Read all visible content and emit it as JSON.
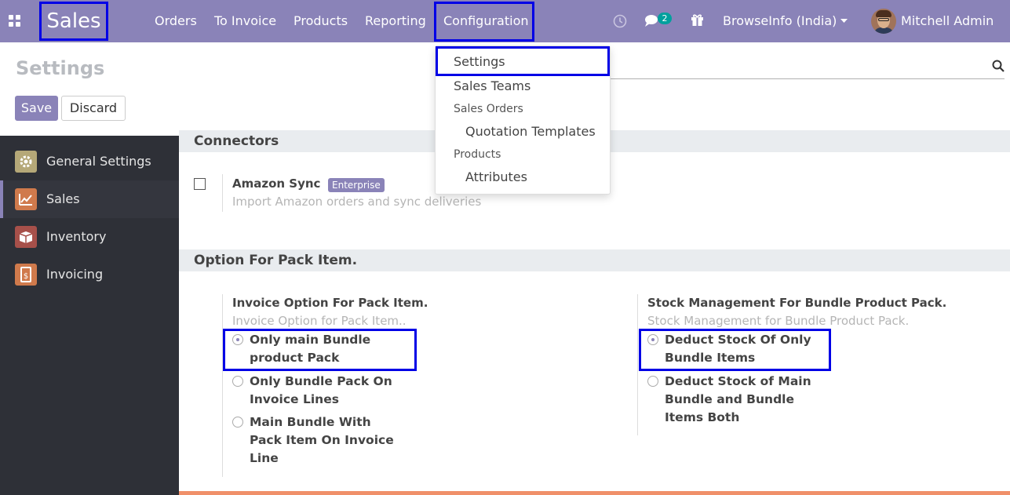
{
  "topbar": {
    "app_name": "Sales",
    "menu": [
      "Orders",
      "To Invoice",
      "Products",
      "Reporting",
      "Configuration"
    ],
    "chat_count": "2",
    "company": "BrowseInfo (India)",
    "user": "Mitchell Admin",
    "icons": [
      "apps-grid-icon",
      "clock-icon",
      "chat-icon",
      "gift-icon",
      "caret-down-icon"
    ]
  },
  "page": {
    "title": "Settings",
    "save_label": "Save",
    "discard_label": "Discard"
  },
  "sidebar": {
    "items": [
      {
        "label": "General Settings",
        "icon": "gear-icon",
        "color": "#b5a878"
      },
      {
        "label": "Sales",
        "icon": "chart-icon",
        "color": "#d07a4c"
      },
      {
        "label": "Inventory",
        "icon": "box-icon",
        "color": "#a7504a"
      },
      {
        "label": "Invoicing",
        "icon": "invoice-icon",
        "color": "#d07a4c"
      }
    ]
  },
  "connectors": {
    "heading": "Connectors",
    "title": "Amazon Sync",
    "badge": "Enterprise",
    "desc": "Import Amazon orders and sync deliveries"
  },
  "pack": {
    "heading": "Option For Pack Item.",
    "invoice": {
      "title": "Invoice Option For Pack Item.",
      "desc": "Invoice Option for Pack Item..",
      "options": [
        {
          "line1": "Only main Bundle",
          "line2": "product Pack",
          "line3": "",
          "selected": true
        },
        {
          "line1": "Only Bundle Pack On",
          "line2": "Invoice Lines",
          "line3": "",
          "selected": false
        },
        {
          "line1": "Main Bundle With",
          "line2": "Pack Item On Invoice",
          "line3": "Line",
          "selected": false
        }
      ]
    },
    "stock": {
      "title": "Stock Management For Bundle Product Pack.",
      "desc": "Stock Management for Bundle Product Pack.",
      "options": [
        {
          "line1": "Deduct Stock Of Only",
          "line2": "Bundle Items",
          "line3": "",
          "selected": true
        },
        {
          "line1": "Deduct Stock of Main",
          "line2": "Bundle and Bundle",
          "line3": "Items Both",
          "selected": false
        }
      ]
    }
  },
  "dropdown": {
    "items": [
      "Settings",
      "Sales Teams",
      "Sales Orders",
      "Quotation Templates",
      "Products",
      "Attributes"
    ]
  },
  "colors": {
    "brand": "#8a83b8",
    "highlight": "#0000e6",
    "sidebar_bg": "#2e3037",
    "badge": "#00a09d"
  }
}
